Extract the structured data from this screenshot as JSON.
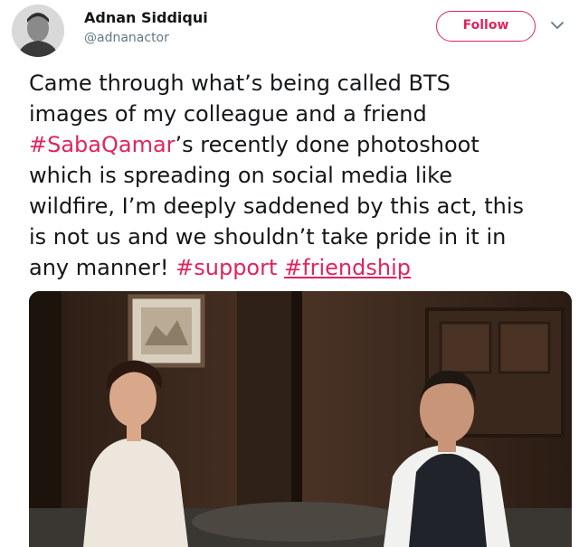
{
  "author": {
    "display_name": "Adnan Siddiqui",
    "handle": "@adnanactor",
    "avatar_icon": "profile-photo"
  },
  "actions": {
    "follow_label": "Follow",
    "more_icon": "chevron-down-icon"
  },
  "colors": {
    "accent": "#e0245e",
    "text": "#14171a",
    "muted": "#657786"
  },
  "tweet": {
    "line1": "Came through what’s being called BTS",
    "line2": "images of my colleague and a friend",
    "line3_hashtag": "#SabaQamar",
    "line3_rest": "’s recently done photoshoot",
    "line4": "which is spreading on social media like",
    "line5": "wildfire, I’m deeply saddened by this act, this",
    "line6": "is not us and we shouldn’t take pride in it in",
    "line7_text": "any manner! ",
    "hashtag_support": "#support",
    "hashtag_friendship": "#friendship"
  },
  "media": {
    "type": "photo"
  }
}
